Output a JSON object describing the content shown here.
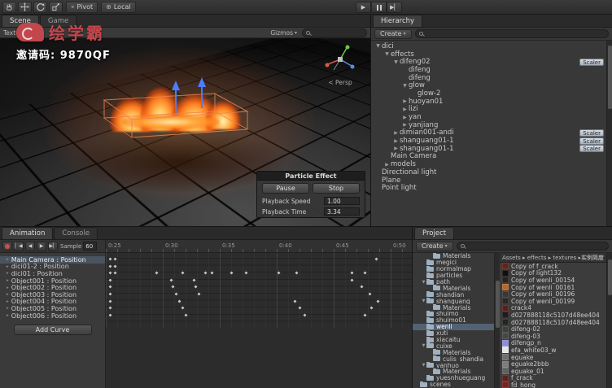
{
  "toolbar": {
    "pivot_label": "Pivot",
    "local_label": "Local"
  },
  "scene": {
    "tabs": [
      "Scene",
      "Game"
    ],
    "view_toolbar": {
      "render_mode": "Textured",
      "gizmos": "Gizmos"
    },
    "watermark": {
      "brand": "绘学霸",
      "invite": "邀请码: 9870QF",
      "brand_color": "#c2474d"
    },
    "persp_label": "< Persp",
    "particle_panel": {
      "title": "Particle Effect",
      "buttons": [
        "Pause",
        "Stop"
      ],
      "fields": [
        {
          "label": "Playback Speed",
          "value": "1.00"
        },
        {
          "label": "Playback Time",
          "value": "3.34"
        }
      ]
    }
  },
  "hierarchy": {
    "tab": "Hierarchy",
    "create": "Create",
    "badge": "Scaler",
    "items": [
      {
        "label": "dici",
        "depth": 0,
        "state": "open"
      },
      {
        "label": "effects",
        "depth": 1,
        "state": "open"
      },
      {
        "label": "difeng02",
        "depth": 2,
        "state": "open",
        "badge": true
      },
      {
        "label": "difeng",
        "depth": 3
      },
      {
        "label": "difeng",
        "depth": 3
      },
      {
        "label": "glow",
        "depth": 3,
        "state": "open"
      },
      {
        "label": "glow-2",
        "depth": 4
      },
      {
        "label": "huoyan01",
        "depth": 3,
        "state": "closed"
      },
      {
        "label": "lizi",
        "depth": 3,
        "state": "closed"
      },
      {
        "label": "yan",
        "depth": 3,
        "state": "closed"
      },
      {
        "label": "yanjiang",
        "depth": 3,
        "state": "closed"
      },
      {
        "label": "dimian001-andi",
        "depth": 2,
        "state": "closed",
        "badge": true
      },
      {
        "label": "shanguang01-1",
        "depth": 2,
        "state": "closed",
        "badge": true
      },
      {
        "label": "shanguang01-1",
        "depth": 2,
        "state": "closed",
        "badge": true
      },
      {
        "label": "Main Camera",
        "depth": 1
      },
      {
        "label": "models",
        "depth": 1,
        "state": "closed"
      },
      {
        "label": "Directional light",
        "depth": 0
      },
      {
        "label": "Plane",
        "depth": 0
      },
      {
        "label": "Point light",
        "depth": 0
      }
    ]
  },
  "animation": {
    "tabs": [
      "Animation",
      "Console"
    ],
    "sample_label": "Sample",
    "sample_value": "60",
    "ruler": [
      "0:25",
      "0:30",
      "0:35",
      "0:40",
      "0:45",
      "0:50"
    ],
    "add_curve": "Add Curve",
    "selected_track": 0,
    "tracks": [
      "Main Camera : Position",
      "dici01-2 : Position",
      "dici01 : Position",
      "Object001 : Position",
      "Object002 : Position",
      "Object003 : Position",
      "Object004 : Position",
      "Object005 : Position",
      "Object006 : Position"
    ],
    "keyframes": [
      {
        "row": 0,
        "x": [
          3,
          9,
          330
        ]
      },
      {
        "row": 1,
        "x": [
          3,
          9
        ]
      },
      {
        "row": 2,
        "x": [
          3,
          9,
          60,
          92,
          120,
          128,
          152,
          170,
          210,
          232,
          300,
          316
        ]
      },
      {
        "row": 3,
        "x": [
          3,
          78,
          106,
          300
        ]
      },
      {
        "row": 4,
        "x": [
          3,
          80,
          108,
          312
        ]
      },
      {
        "row": 5,
        "x": [
          3,
          84,
          112,
          322
        ]
      },
      {
        "row": 6,
        "x": [
          3,
          88,
          230,
          332
        ]
      },
      {
        "row": 7,
        "x": [
          3,
          92,
          236,
          324
        ]
      },
      {
        "row": 8,
        "x": [
          3,
          96,
          242,
          316
        ]
      }
    ]
  },
  "project": {
    "tab": "Project",
    "create": "Create",
    "breadcrumb": "Assets ▸ effects ▸ textures ▸",
    "breadcrumb_note": "实例简度材质",
    "folders": [
      {
        "label": "Materials",
        "depth": 2
      },
      {
        "label": "megici",
        "depth": 1
      },
      {
        "label": "normalmap",
        "depth": 1
      },
      {
        "label": "particles",
        "depth": 1
      },
      {
        "label": "path",
        "depth": 1,
        "state": "open"
      },
      {
        "label": "Materials",
        "depth": 2
      },
      {
        "label": "shandian",
        "depth": 1
      },
      {
        "label": "shanguang",
        "depth": 1,
        "state": "open"
      },
      {
        "label": "Materials",
        "depth": 2
      },
      {
        "label": "shuimo",
        "depth": 1
      },
      {
        "label": "shuimo01",
        "depth": 1
      },
      {
        "label": "wenli",
        "depth": 1,
        "selected": true
      },
      {
        "label": "xuti",
        "depth": 1
      },
      {
        "label": "xiacaitu",
        "depth": 1
      },
      {
        "label": "cuixe",
        "depth": 1,
        "state": "open"
      },
      {
        "label": "Materials",
        "depth": 2
      },
      {
        "label": "culis_shandia",
        "depth": 2
      },
      {
        "label": "yanhuo",
        "depth": 1,
        "state": "open"
      },
      {
        "label": "Materials",
        "depth": 2
      },
      {
        "label": "yuesnhueguang",
        "depth": 1
      },
      {
        "label": "scenes",
        "depth": 0
      }
    ],
    "assets": [
      {
        "label": "Copy of f_crack",
        "color": "#5d241a"
      },
      {
        "label": "Copy of light132",
        "color": "#101010"
      },
      {
        "label": "Copy of wenli_00154",
        "color": "#27221e"
      },
      {
        "label": "Copy of wenli_00161",
        "color": "#b4682c"
      },
      {
        "label": "Copy of wenli_00196",
        "color": "#3a3734"
      },
      {
        "label": "Copy of wenli_00199",
        "color": "#2b2724"
      },
      {
        "label": "crack4",
        "color": "#55211a"
      },
      {
        "label": "d027888118c5107d48ee404",
        "color": "#1c1c1c"
      },
      {
        "label": "d027888118c5107d48ee404",
        "color": "#242424"
      },
      {
        "label": "difeng-02",
        "color": "#39423a"
      },
      {
        "label": "difeng-03",
        "color": "#474747"
      },
      {
        "label": "difengp_n",
        "color": "#8d8dd8"
      },
      {
        "label": "efa_white03_w",
        "color": "#e6e6e6"
      },
      {
        "label": "eguake",
        "color": "#6f6f6f"
      },
      {
        "label": "eguake2bbb",
        "color": "#7d7d7d"
      },
      {
        "label": "eguake_01",
        "color": "#616161"
      },
      {
        "label": "f_crack",
        "color": "#58241c"
      },
      {
        "label": "fd_hong",
        "color": "#7c1f1f"
      }
    ]
  }
}
